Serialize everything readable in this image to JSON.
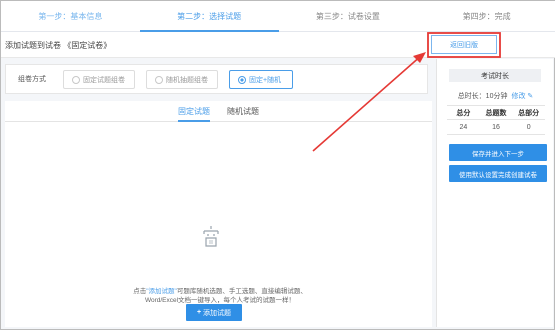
{
  "steps": [
    {
      "label": "第一步：基本信息"
    },
    {
      "label": "第二步：选择试题"
    },
    {
      "label": "第三步：试卷设置"
    },
    {
      "label": "第四步：完成"
    }
  ],
  "header": {
    "title": "添加试题到试卷 《固定试卷》",
    "back_label": "返回旧版"
  },
  "mode": {
    "label": "组卷方式",
    "options": [
      {
        "label": "固定试题组卷",
        "selected": false
      },
      {
        "label": "随机抽题组卷",
        "selected": false
      },
      {
        "label": "固定+随机",
        "selected": true
      }
    ]
  },
  "tabs": [
    {
      "label": "固定试题",
      "active": true
    },
    {
      "label": "随机试题",
      "active": false
    }
  ],
  "empty": {
    "prefix": "点击",
    "link": "\"添加试题\"",
    "line1_rest": "可题库随机选题、手工选题、直接编辑试题、",
    "line2": "Word/Excel文档一键导入，每个人考试的试题一样！",
    "add_label": "添加试题"
  },
  "sidebar": {
    "head": "考试时长",
    "duration_text": "总时长：10分钟",
    "edit_label": "修改",
    "cols": [
      "总分",
      "总题数",
      "总部分"
    ],
    "values": [
      "24",
      "16",
      "0"
    ],
    "save_next_label": "保存并进入下一步",
    "default_create_label": "使用默认设置完成创建试卷"
  },
  "colors": {
    "accent": "#4a9de8",
    "button": "#2f8fe6",
    "arrow": "#e53935"
  }
}
